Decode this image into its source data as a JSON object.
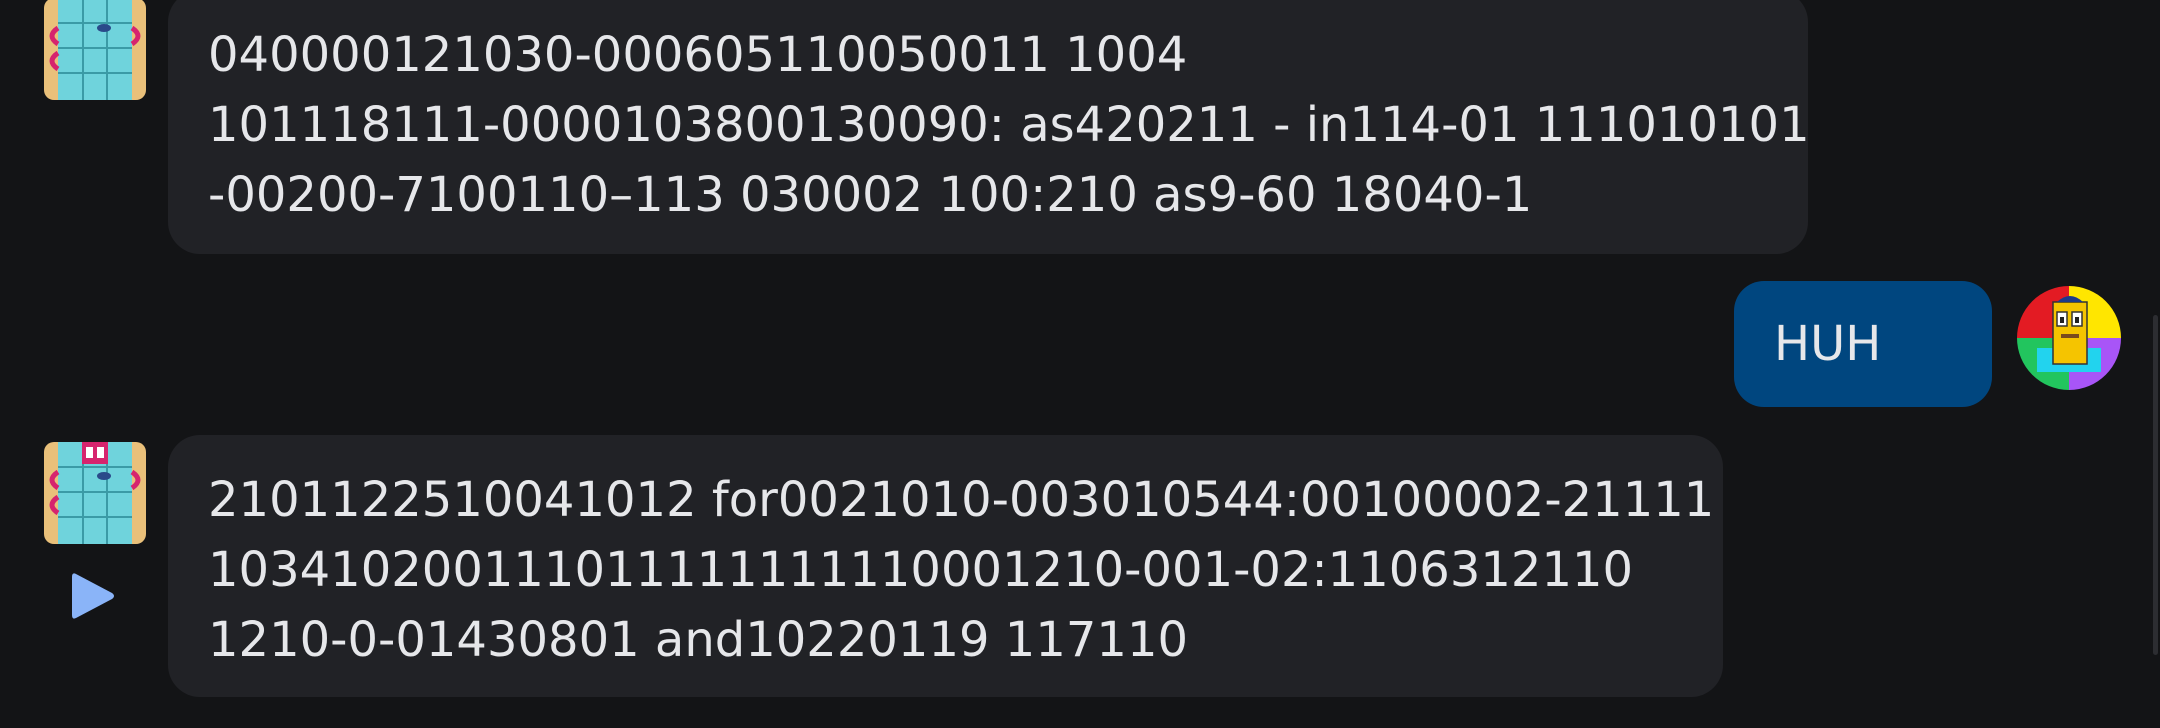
{
  "colors": {
    "background": "#131416",
    "bot_bubble": "#212226",
    "user_bubble": "#00467f",
    "text": "#e6e7ea",
    "play_icon": "#8ab4f8",
    "top_fragment": "#e0335e"
  },
  "messages": [
    {
      "sender": "bot",
      "avatar_icon": "numberblock-avatar-icon",
      "lines": [
        "040000121030-000605110050011 1004",
        "101118111-0000103800130090: as420211 - in114-01 111010101",
        "-00200-7100110–113 030002 100:210 as9-60 18040-1"
      ]
    },
    {
      "sender": "user",
      "avatar_icon": "user-colorful-avatar-icon",
      "lines": [
        "HUH"
      ]
    },
    {
      "sender": "bot",
      "avatar_icon": "numberblock-avatar-icon",
      "lines": [
        "2101122510041012 for0021010-003010544:00100002-21111",
        "103410200111011111111110001210-001-02:1106312110",
        "1210-0-01430801 and10220119 117110"
      ],
      "play_icon": "play-icon"
    }
  ]
}
